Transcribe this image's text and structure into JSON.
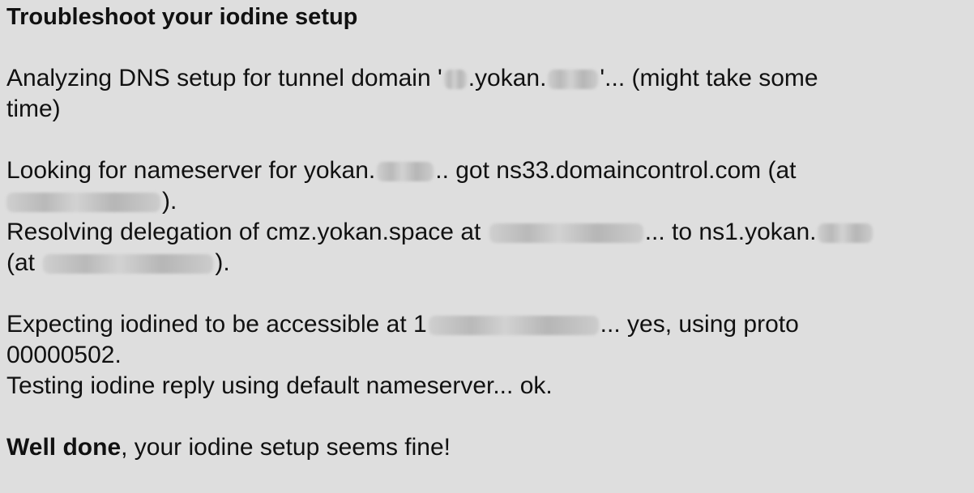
{
  "title": "Troubleshoot your iodine setup",
  "analyzing": {
    "prefix": "Analyzing DNS setup for tunnel domain '",
    "domain_mid": ".yokan.",
    "suffix": "'... (might take some",
    "wrap": "time)"
  },
  "looking": {
    "prefix": "Looking for nameserver for yokan.",
    "mid": ".. got ns33.domaincontrol.com (at",
    "wrap_suffix": ")."
  },
  "resolving": {
    "prefix": "Resolving delegation of cmz.yokan.space at",
    "mid": "... to ns1.yokan.",
    "wrap_prefix": "(at",
    "wrap_suffix": ")."
  },
  "expecting": {
    "prefix": "Expecting iodined to be accessible at 1",
    "suffix": "... yes, using proto",
    "wrap": "00000502."
  },
  "testing": "Testing iodine reply using default nameserver... ok.",
  "final": {
    "bold": "Well done",
    "rest": ", your iodine setup seems fine!"
  }
}
